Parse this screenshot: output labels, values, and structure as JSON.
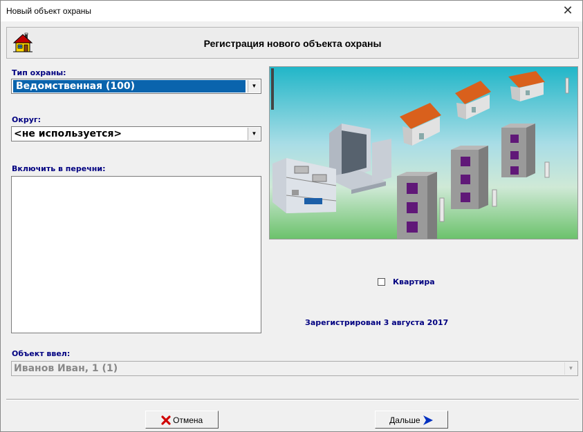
{
  "window": {
    "title": "Новый объект охраны",
    "close_icon": "✕"
  },
  "header": {
    "icon": "house-icon",
    "title": "Регистрация нового объекта охраны"
  },
  "form": {
    "guard_type": {
      "label": "Тип охраны:",
      "value": "Ведомственная (100)"
    },
    "district": {
      "label": "Округ:",
      "value": "<не используется>"
    },
    "include_lists": {
      "label": "Включить в перечни:",
      "items": []
    },
    "apartment": {
      "label": "Квартира",
      "checked": false
    },
    "registration_status": "Зарегистрирован  3 августа 2017",
    "entered_by": {
      "label": "Объект ввел:",
      "value": "Иванов Иван, 1 (1)"
    }
  },
  "picture": {
    "icon": "security-network-illustration"
  },
  "buttons": {
    "cancel": {
      "label": "Отмена",
      "icon": "red-x-icon"
    },
    "next": {
      "label": "Дальше",
      "icon": "blue-arrow-right-icon"
    }
  },
  "colors": {
    "label_text": "#000080",
    "selection": "#0a64ad",
    "cancel_icon": "#d00000",
    "next_icon": "#0030c0"
  }
}
